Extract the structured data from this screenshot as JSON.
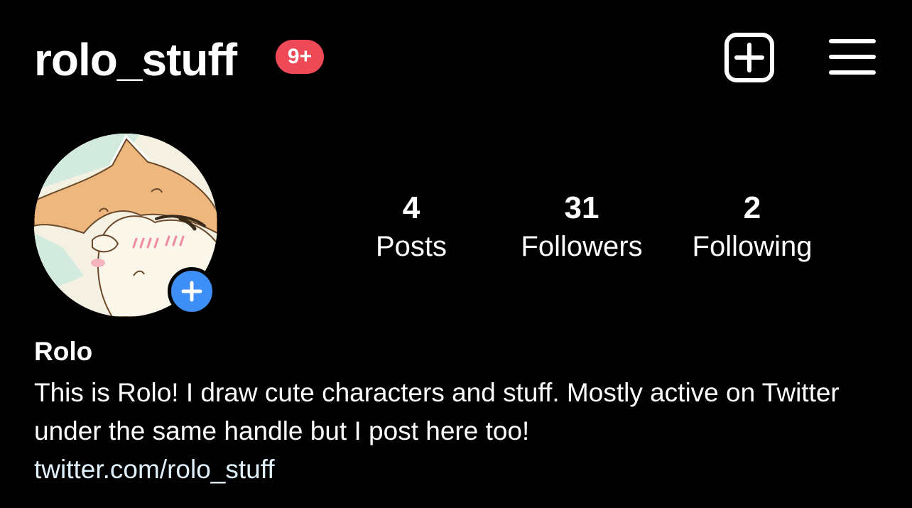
{
  "header": {
    "username": "rolo_stuff",
    "notification_badge": "9+",
    "icons": {
      "new_post": "plus-square-icon",
      "menu": "hamburger-menu-icon"
    }
  },
  "profile": {
    "avatar": "cartoon-character-avatar",
    "add_story_icon": "plus-icon",
    "stats": {
      "posts": {
        "value": "4",
        "label": "Posts"
      },
      "followers": {
        "value": "31",
        "label": "Followers"
      },
      "following": {
        "value": "2",
        "label": "Following"
      }
    },
    "display_name": "Rolo",
    "bio": "This is Rolo! I draw cute characters and stuff. Mostly active on Twitter under the same handle but I post here too!",
    "link": "twitter.com/rolo_stuff"
  },
  "colors": {
    "background": "#000000",
    "text": "#ffffff",
    "badge": "#ed4956",
    "accent_blue": "#3d8ef5",
    "link": "#e0f1ff"
  }
}
